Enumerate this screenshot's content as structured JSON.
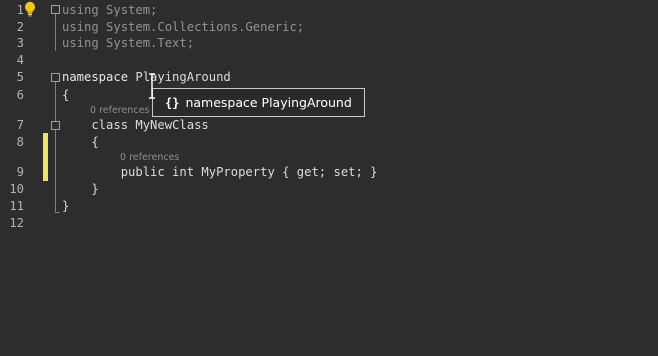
{
  "editor": {
    "line_numbers": [
      "1",
      "2",
      "3",
      "4",
      "5",
      "6",
      "7",
      "8",
      "9",
      "10",
      "11",
      "12"
    ],
    "lines": {
      "l1": "using System;",
      "l2": "using System.Collections.Generic;",
      "l3": "using System.Text;",
      "l5_kw": "namespace ",
      "l5_name": "PlayingAround",
      "l6": "{",
      "l7": "    class MyNewClass",
      "l8": "    {",
      "l9": "        public int MyProperty { get; set; }",
      "l10": "    }",
      "l11": "}"
    },
    "codelens": {
      "class_refs": "0 references",
      "property_refs": "0 references"
    },
    "quick_info": {
      "icon": "{}",
      "text": "namespace PlayingAround"
    },
    "colors": {
      "background": "#2d2d2d",
      "text": "#dcdcdc",
      "dim_text": "#939393",
      "line_number": "#b3b3b3",
      "change_bar": "#efe165",
      "tooltip_border": "#c8c8c8"
    },
    "icons": [
      "lightbulb-icon",
      "namespace-icon",
      "text-cursor-icon"
    ]
  }
}
